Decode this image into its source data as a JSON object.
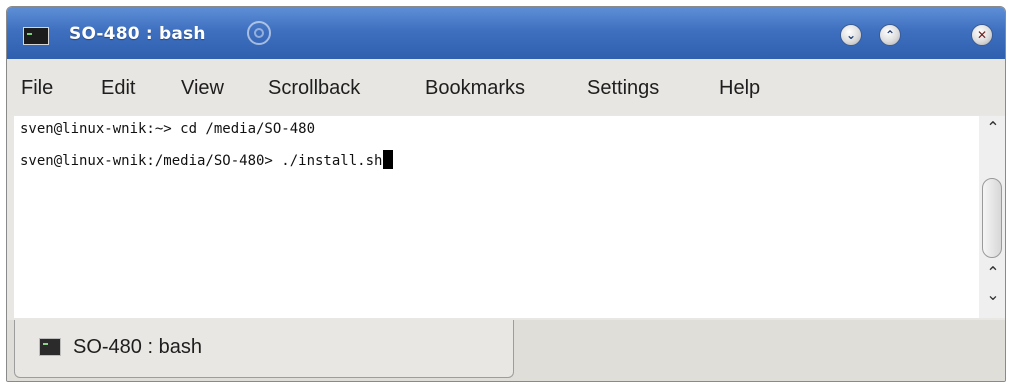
{
  "window": {
    "title": "SO-480 : bash"
  },
  "menu": {
    "items": [
      "File",
      "Edit",
      "View",
      "Scrollback",
      "Bookmarks",
      "Settings",
      "Help"
    ]
  },
  "terminal": {
    "lines": [
      "sven@linux-wnik:~> cd /media/SO-480",
      "sven@linux-wnik:/media/SO-480> ./install.sh"
    ]
  },
  "tabs": [
    {
      "label": "SO-480 : bash",
      "icon": "terminal-icon"
    }
  ],
  "icons": {
    "app": "terminal-icon",
    "pin": "sticky-pin-icon",
    "minimize": "chevron-down-icon",
    "maximize": "chevron-up-icon",
    "close": "close-icon"
  },
  "colors": {
    "titlebar": "#3f70c0",
    "terminal_bg": "#ffffff",
    "text": "#111111"
  }
}
